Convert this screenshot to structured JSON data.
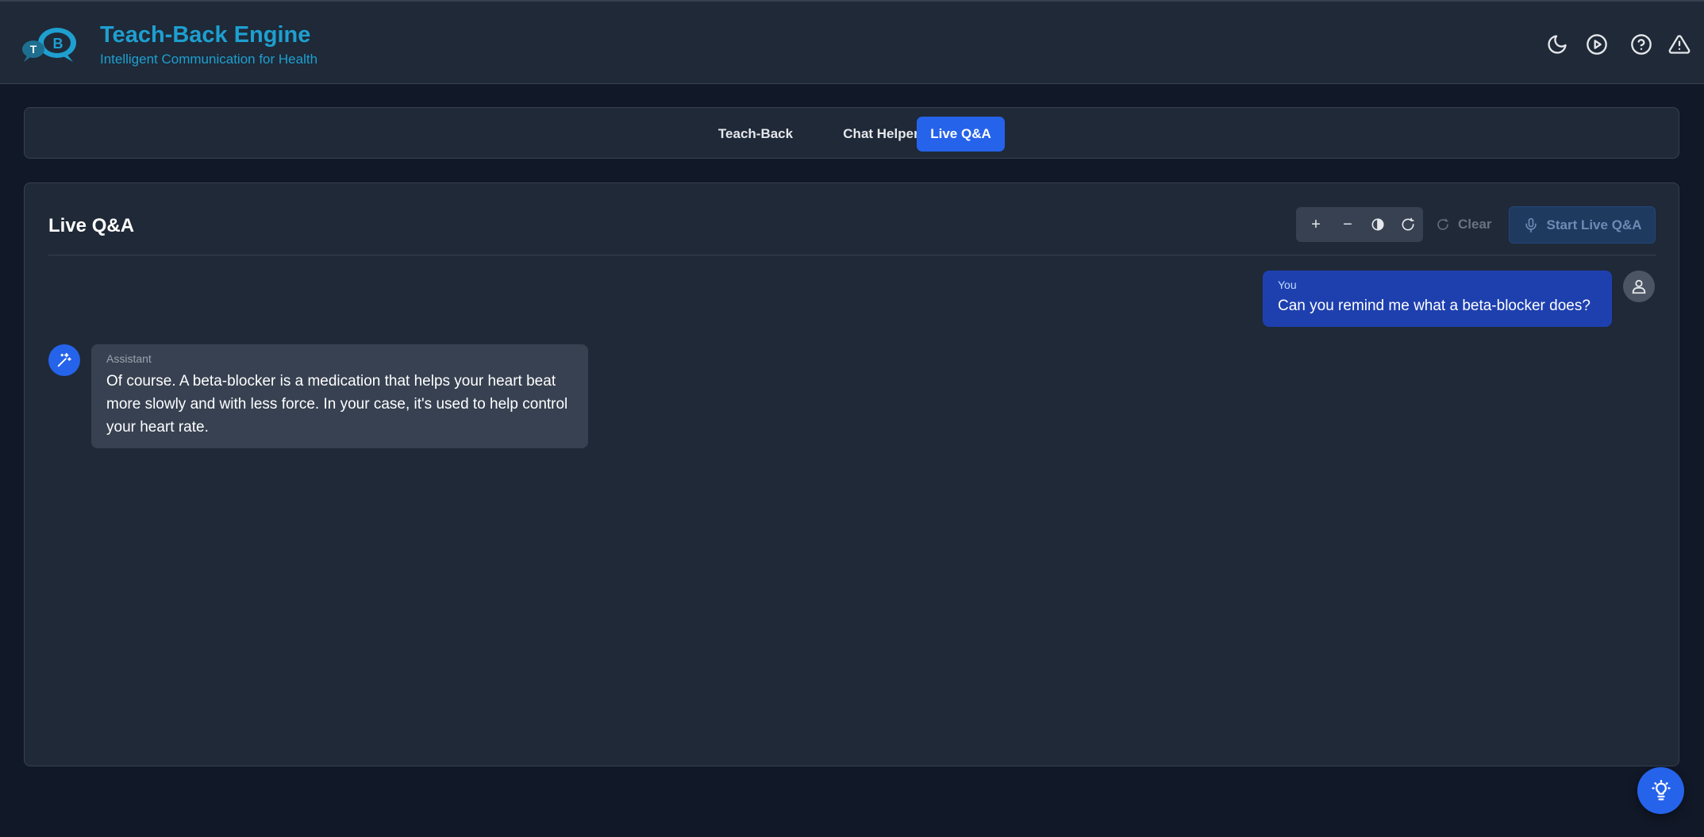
{
  "header": {
    "logo_letters": [
      "T",
      "B"
    ],
    "title": "Teach-Back Engine",
    "subtitle": "Intelligent Communication for Health",
    "icons": [
      "moon-icon",
      "play-circle-icon",
      "help-circle-icon",
      "warning-triangle-icon"
    ]
  },
  "tabs": [
    {
      "label": "Teach-Back",
      "active": false
    },
    {
      "label": "Chat Helper",
      "active": false
    },
    {
      "label": "Live Q&A",
      "active": true
    }
  ],
  "panel": {
    "title": "Live Q&A",
    "accessibility_controls": {
      "increase": "+",
      "decrease": "−",
      "icons": [
        "plus-icon",
        "minus-icon",
        "contrast-icon",
        "reset-icon"
      ]
    },
    "clear_label": "Clear",
    "start_label": "Start Live Q&A"
  },
  "messages": [
    {
      "role": "user",
      "label": "You",
      "text": "Can you remind me what a beta-blocker does?"
    },
    {
      "role": "assistant",
      "label": "Assistant",
      "text": "Of course. A beta-blocker is a medication that helps your heart beat more slowly and with less force. In your case, it's used to help control your heart rate."
    }
  ],
  "fab": {
    "icon": "lightbulb-icon"
  },
  "colors": {
    "background": "#111827",
    "surface": "#1f2937",
    "accent": "#2563eb",
    "brand": "#1e9fd0",
    "user_bubble": "#1e40af",
    "assistant_bubble": "#374151"
  }
}
